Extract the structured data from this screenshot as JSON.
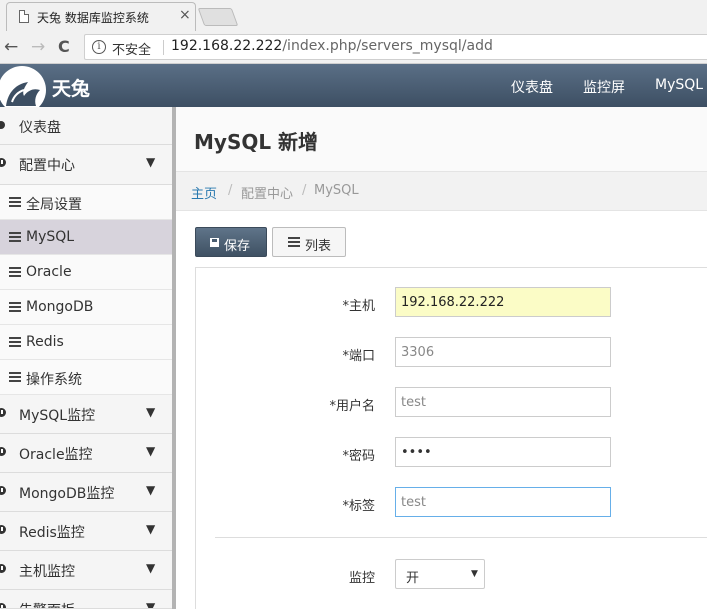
{
  "browser": {
    "tab_title": "天兔 数据库监控系统",
    "tab_close": "×",
    "security_label": "不安全",
    "url_host": "192.168.22.222",
    "url_path": "/index.php/servers_mysql/add",
    "back": "←",
    "forward": "→",
    "reload": "C"
  },
  "header": {
    "brand": "天兔",
    "nav": [
      "仪表盘",
      "监控屏",
      "MySQL"
    ]
  },
  "sidebar": {
    "items": [
      {
        "label": "仪表盘",
        "type": "top",
        "icon": "dot-icon"
      },
      {
        "label": "配置中心",
        "type": "top",
        "icon": "gauge-icon",
        "chevron": true
      },
      {
        "label": "全局设置",
        "type": "sub",
        "icon": "list-icon"
      },
      {
        "label": "MySQL",
        "type": "sub",
        "icon": "list-icon",
        "active": true
      },
      {
        "label": "Oracle",
        "type": "sub",
        "icon": "list-icon"
      },
      {
        "label": "MongoDB",
        "type": "sub",
        "icon": "list-icon"
      },
      {
        "label": "Redis",
        "type": "sub",
        "icon": "list-icon"
      },
      {
        "label": "操作系统",
        "type": "sub",
        "icon": "list-icon"
      },
      {
        "label": "MySQL监控",
        "type": "top",
        "icon": "gauge-icon",
        "chevron": true
      },
      {
        "label": "Oracle监控",
        "type": "top",
        "icon": "gauge-icon",
        "chevron": true
      },
      {
        "label": "MongoDB监控",
        "type": "top",
        "icon": "gauge-icon",
        "chevron": true
      },
      {
        "label": "Redis监控",
        "type": "top",
        "icon": "gauge-icon",
        "chevron": true
      },
      {
        "label": "主机监控",
        "type": "top",
        "icon": "gauge-icon",
        "chevron": true
      },
      {
        "label": "告警面板",
        "type": "top",
        "icon": "gauge-icon",
        "chevron": true
      }
    ],
    "chevron_glyph": "▼"
  },
  "main": {
    "title": "MySQL 新增",
    "breadcrumb": [
      "主页",
      "配置中心",
      "MySQL"
    ],
    "breadcrumb_sep": "/",
    "save_label": "保存",
    "list_label": "列表"
  },
  "form": {
    "host_label": "*主机",
    "host_value": "192.168.22.222",
    "port_label": "*端口",
    "port_value": "3306",
    "user_label": "*用户名",
    "user_value": "test",
    "password_label": "*密码",
    "password_value": "••••",
    "tag_label": "*标签",
    "tag_value": "test",
    "monitor_label": "监控",
    "monitor_value": "开"
  }
}
